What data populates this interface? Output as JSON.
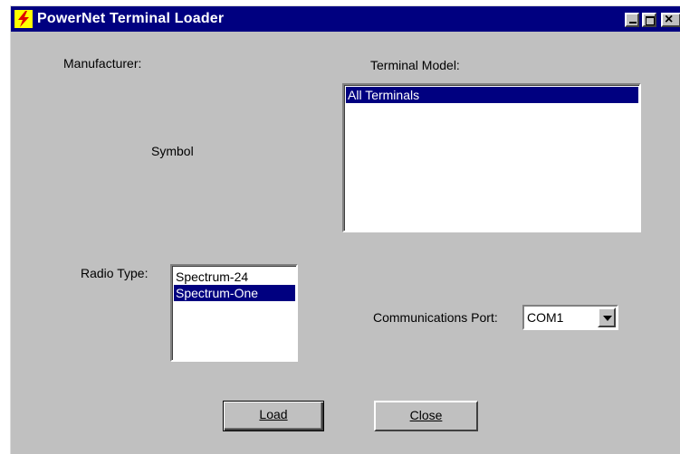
{
  "window": {
    "title": "PowerNet Terminal Loader",
    "icon": "lightning-app-icon",
    "controls": [
      "minimize-icon",
      "maximize-icon",
      "close-icon"
    ]
  },
  "manufacturer": {
    "label": "Manufacturer:",
    "value": "Symbol"
  },
  "terminal_model": {
    "label": "Terminal Model:",
    "items": [
      "All Terminals"
    ],
    "selected_index": 0
  },
  "radio_type": {
    "label": "Radio Type:",
    "items": [
      "Spectrum-24",
      "Spectrum-One"
    ],
    "selected_index": 1
  },
  "comm_port": {
    "label": "Communications Port:",
    "value": "COM1"
  },
  "buttons": {
    "load": "Load",
    "close": "Close"
  },
  "colors": {
    "titlebar": "#000080",
    "face": "#c0c0c0",
    "selection": "#000080"
  }
}
